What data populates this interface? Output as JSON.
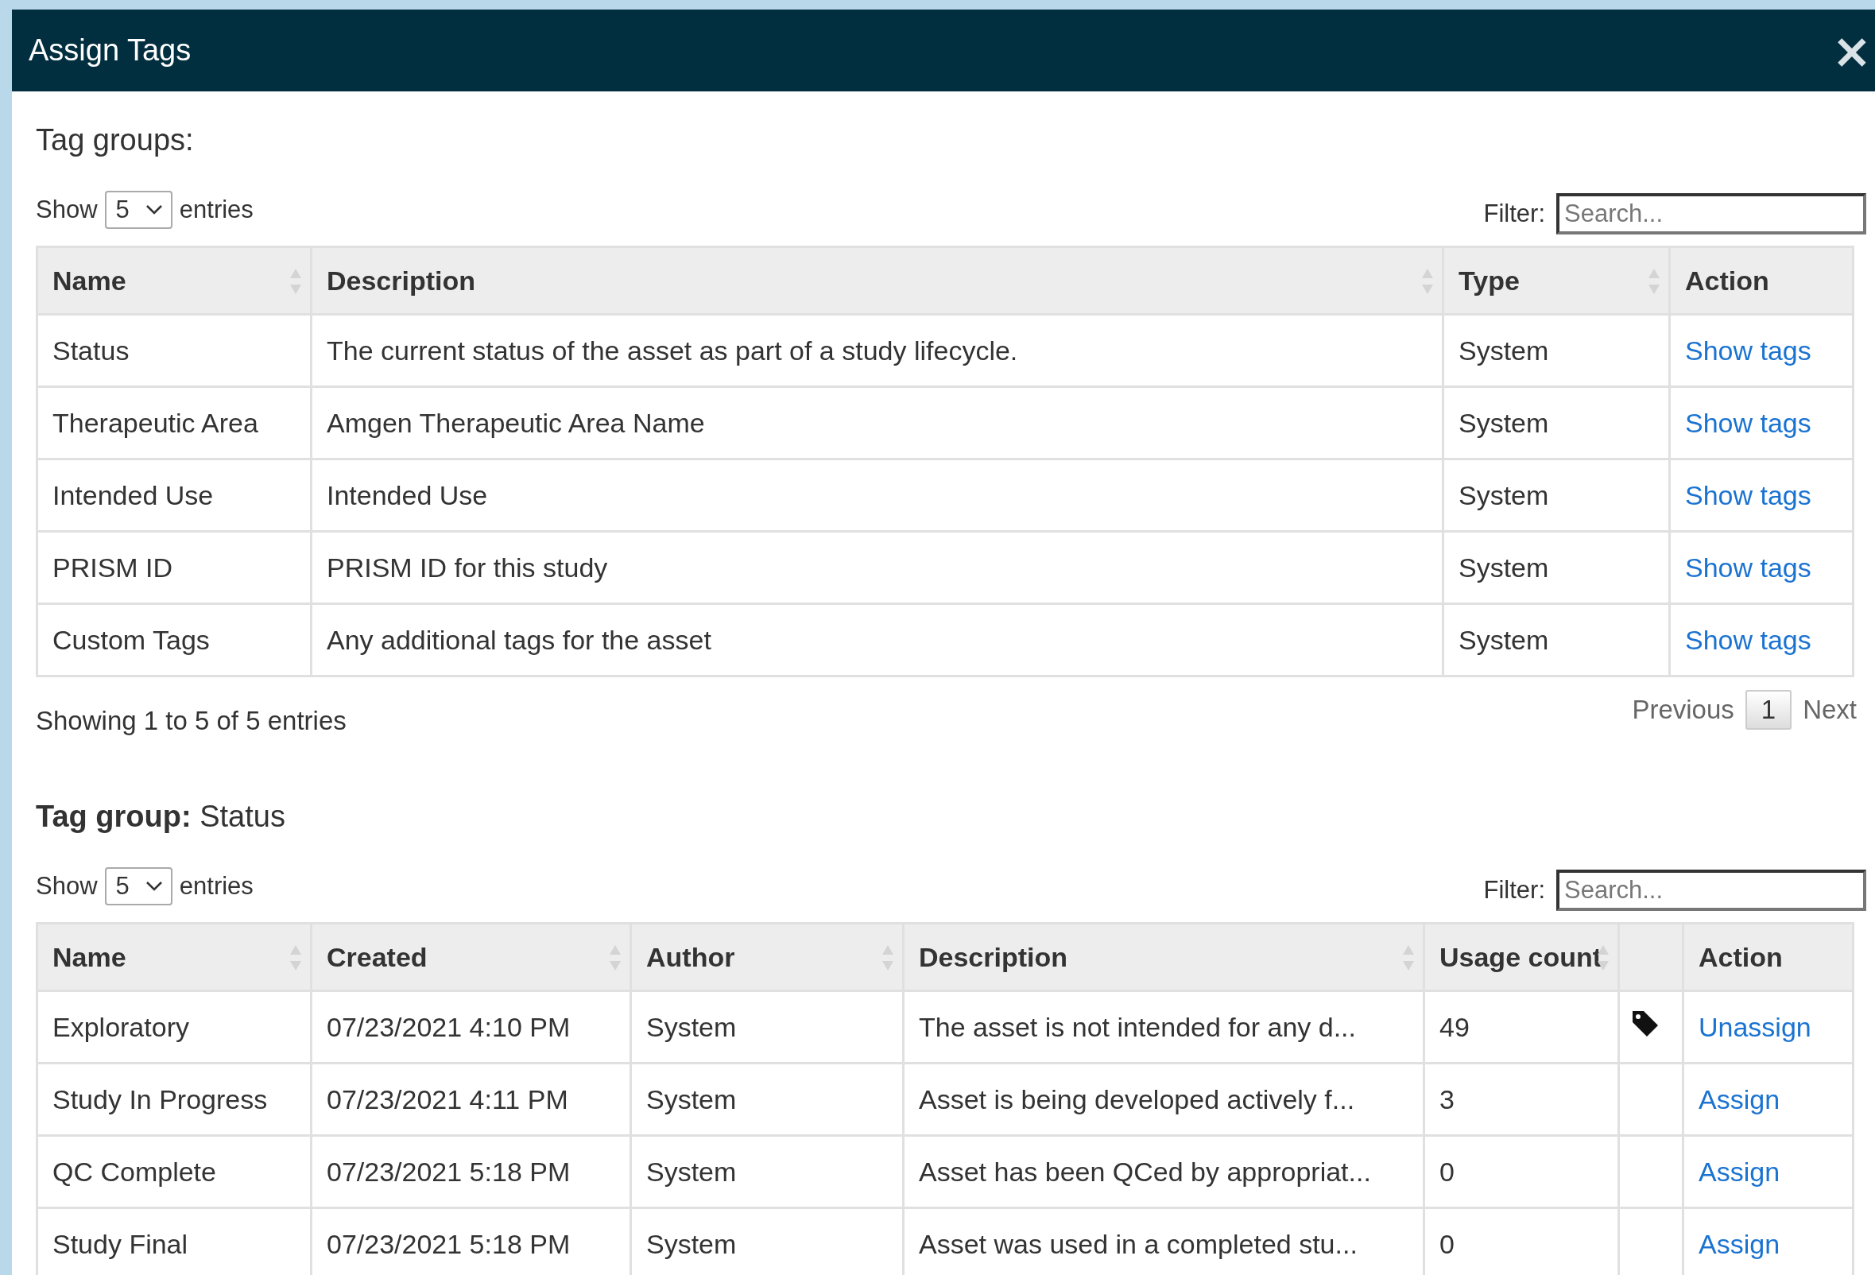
{
  "dialog": {
    "title": "Assign Tags",
    "close": "×"
  },
  "sections": [
    {
      "heading": "Tag groups:",
      "length": {
        "before": "Show",
        "value": "5",
        "after": "entries"
      },
      "filter": {
        "label": "Filter:",
        "placeholder": "Search..."
      },
      "columns": [
        {
          "label": "Name",
          "kind": "text",
          "sortable": true
        },
        {
          "label": "Description",
          "kind": "text",
          "sortable": true
        },
        {
          "label": "Type",
          "kind": "text",
          "sortable": true
        },
        {
          "label": "Action",
          "kind": "action",
          "sortable": false
        }
      ],
      "rows": [
        {
          "cells": [
            "Status",
            "The current status of the asset as part of a study lifecycle.",
            "System"
          ],
          "action": "Show tags"
        },
        {
          "cells": [
            "Therapeutic Area",
            "Amgen Therapeutic Area Name",
            "System"
          ],
          "action": "Show tags"
        },
        {
          "cells": [
            "Intended Use",
            "Intended Use",
            "System"
          ],
          "action": "Show tags"
        },
        {
          "cells": [
            "PRISM ID",
            "PRISM ID for this study",
            "System"
          ],
          "action": "Show tags"
        },
        {
          "cells": [
            "Custom Tags",
            "Any additional tags for the asset",
            "System"
          ],
          "action": "Show tags"
        }
      ],
      "info": "Showing 1 to 5 of 5 entries",
      "pagination": [
        {
          "label": "Previous",
          "kind": "nav",
          "disabled": true
        },
        {
          "label": "1",
          "kind": "page",
          "selected": true
        },
        {
          "label": "Next",
          "kind": "nav",
          "disabled": true
        }
      ]
    },
    {
      "heading": "**Tag group:** Status",
      "length": {
        "before": "Show",
        "value": "5",
        "after": "entries"
      },
      "filter": {
        "label": "Filter:",
        "placeholder": "Search..."
      },
      "columns": [
        {
          "label": "Name",
          "kind": "text",
          "sortable": true
        },
        {
          "label": "Created",
          "kind": "text",
          "sortable": true
        },
        {
          "label": "Author",
          "kind": "text",
          "sortable": true
        },
        {
          "label": "Description",
          "kind": "text",
          "sortable": true
        },
        {
          "label": "Usage count",
          "kind": "text",
          "sortable": true
        },
        {
          "kind": "icon",
          "sortable": false
        },
        {
          "label": "Action",
          "kind": "action",
          "sortable": false
        }
      ],
      "rows": [
        {
          "cells": [
            "Exploratory",
            "07/23/2021 4:10 PM",
            "System",
            "The asset is not intended for any d...",
            "49"
          ],
          "tagged": true,
          "action": "Unassign"
        },
        {
          "cells": [
            "Study In Progress",
            "07/23/2021 4:11 PM",
            "System",
            "Asset is being developed actively f...",
            "3"
          ],
          "tagged": false,
          "action": "Assign"
        },
        {
          "cells": [
            "QC Complete",
            "07/23/2021 5:18 PM",
            "System",
            "Asset has been QCed by appropriat...",
            "0"
          ],
          "tagged": false,
          "action": "Assign"
        },
        {
          "cells": [
            "Study Final",
            "07/23/2021 5:18 PM",
            "System",
            "Asset was used in a completed stu...",
            "0"
          ],
          "tagged": false,
          "action": "Assign"
        }
      ]
    }
  ]
}
